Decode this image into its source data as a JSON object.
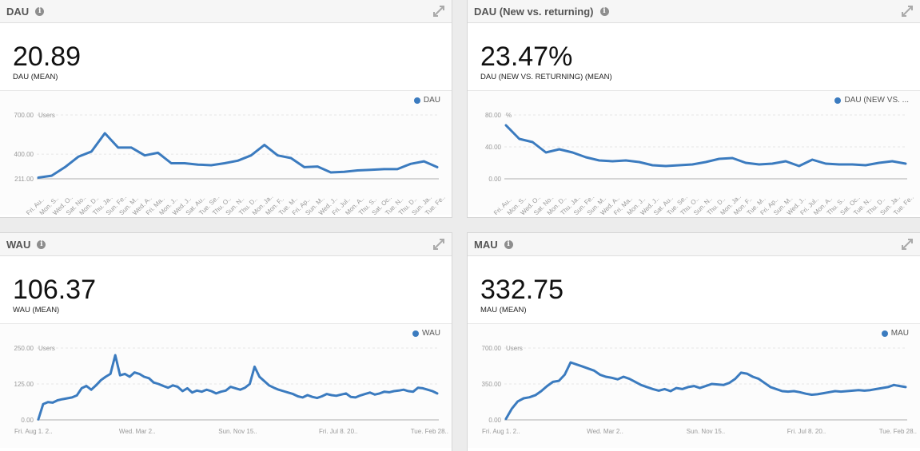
{
  "colors": {
    "series": "#3b7bbf",
    "grid": "#e6e6e6",
    "axis": "#c8c8c8",
    "text": "#9a9a9a"
  },
  "widgets": [
    {
      "title": "DAU",
      "kpi_value": "20.89",
      "kpi_label": "DAU (MEAN)",
      "legend": "DAU",
      "unit": "Users",
      "info_icon": "info-icon",
      "expand_icon": "expand-icon"
    },
    {
      "title": "DAU (New vs. returning)",
      "kpi_value": "23.47%",
      "kpi_label": "DAU (NEW VS. RETURNING) (MEAN)",
      "legend": "DAU (NEW VS. ...",
      "unit": "%",
      "info_icon": "info-icon",
      "expand_icon": "expand-icon"
    },
    {
      "title": "WAU",
      "kpi_value": "106.37",
      "kpi_label": "WAU (MEAN)",
      "legend": "WAU",
      "unit": "Users",
      "info_icon": "info-icon",
      "expand_icon": "expand-icon"
    },
    {
      "title": "MAU",
      "kpi_value": "332.75",
      "kpi_label": "MAU (MEAN)",
      "legend": "MAU",
      "unit": "Users",
      "info_icon": "info-icon",
      "expand_icon": "expand-icon"
    }
  ],
  "chart_data": [
    {
      "type": "line",
      "title": "DAU",
      "ylabel": "Users",
      "y_ticks": [
        "211.00",
        "400.00",
        "700.00"
      ],
      "ylim": [
        211,
        700
      ],
      "grid": true,
      "legend_placement": "top-right",
      "x_tick_labels": [
        "Fri. Au..",
        "Mon. S..",
        "Wed. O..",
        "Sat. No..",
        "Mon. D..",
        "Thu. Ja..",
        "Sun. Fe..",
        "Sun. M..",
        "Wed. A..",
        "Fri. Ma..",
        "Mon. J..",
        "Wed. J..",
        "Sat. Au..",
        "Tue. Se..",
        "Thu. O..",
        "Sun. N..",
        "Thu. D..",
        "Mon. Ja..",
        "Mon. F..",
        "Tue. M..",
        "Fri. Ap..",
        "Sun. M..",
        "Wed. J..",
        "Fri. Jul..",
        "Mon. A..",
        "Thu. S..",
        "Sat. Oc..",
        "Tue. N..",
        "Thu. D..",
        "Sun. Ja..",
        "Tue. Fe.."
      ],
      "series": [
        {
          "name": "DAU",
          "values": [
            220,
            235,
            300,
            380,
            420,
            560,
            450,
            450,
            390,
            410,
            330,
            330,
            320,
            315,
            330,
            350,
            390,
            470,
            390,
            370,
            300,
            305,
            260,
            265,
            275,
            280,
            285,
            285,
            325,
            345,
            300
          ]
        }
      ]
    },
    {
      "type": "line",
      "title": "DAU (New vs. returning)",
      "ylabel": "%",
      "y_ticks": [
        "0.00",
        "40.00",
        "80.00"
      ],
      "ylim": [
        0,
        80
      ],
      "grid": true,
      "legend_placement": "top-right",
      "x_tick_labels": [
        "Fri. Au..",
        "Mon. S..",
        "Wed. O..",
        "Sat. No..",
        "Mon. D..",
        "Thu. Ja..",
        "Sun. Fe..",
        "Sun. M..",
        "Wed. A..",
        "Fri. Ma..",
        "Mon. J..",
        "Wed. J..",
        "Sat. Au..",
        "Tue. Se..",
        "Thu. O..",
        "Sun. N..",
        "Thu. D..",
        "Mon. Ja..",
        "Mon. F..",
        "Tue. M..",
        "Fri. Ap..",
        "Sun. M..",
        "Wed. J..",
        "Fri. Jul..",
        "Mon. A..",
        "Thu. S..",
        "Sat. Oc..",
        "Tue. N..",
        "Thu. D..",
        "Sun. Ja..",
        "Tue. Fe.."
      ],
      "series": [
        {
          "name": "DAU (NEW VS. ...",
          "values": [
            67,
            50,
            46,
            33,
            37,
            33,
            27,
            23,
            22,
            23,
            21,
            17,
            16,
            17,
            18,
            21,
            25,
            26,
            20,
            18,
            19,
            22,
            16,
            24,
            19,
            18,
            18,
            17,
            20,
            22,
            19
          ]
        }
      ]
    },
    {
      "type": "line",
      "title": "WAU",
      "ylabel": "Users",
      "y_ticks": [
        "0.00",
        "125.00",
        "250.00"
      ],
      "ylim": [
        0,
        250
      ],
      "grid": true,
      "legend_placement": "top-right",
      "x_tick_labels": [
        "Fri. Aug 1. 2..",
        "Wed. Mar 2..",
        "Sun. Nov 15..",
        "Fri. Jul 8. 20..",
        "Tue. Feb 28.."
      ],
      "series": [
        {
          "name": "WAU",
          "values": [
            2,
            55,
            62,
            60,
            68,
            72,
            75,
            78,
            85,
            110,
            118,
            105,
            120,
            138,
            150,
            160,
            225,
            155,
            160,
            150,
            165,
            160,
            150,
            145,
            130,
            125,
            118,
            112,
            120,
            115,
            100,
            110,
            95,
            102,
            98,
            105,
            100,
            92,
            98,
            102,
            115,
            110,
            105,
            112,
            125,
            185,
            150,
            135,
            120,
            112,
            105,
            100,
            95,
            90,
            82,
            78,
            86,
            80,
            76,
            82,
            90,
            86,
            84,
            88,
            92,
            80,
            78,
            85,
            90,
            95,
            88,
            92,
            98,
            96,
            100,
            102,
            105,
            100,
            98,
            112,
            110,
            105,
            100,
            92
          ]
        }
      ]
    },
    {
      "type": "line",
      "title": "MAU",
      "ylabel": "Users",
      "y_ticks": [
        "0.00",
        "350.00",
        "700.00"
      ],
      "ylim": [
        0,
        700
      ],
      "grid": true,
      "legend_placement": "top-right",
      "x_tick_labels": [
        "Fri. Aug 1. 2..",
        "Wed. Mar 2..",
        "Sun. Nov 15..",
        "Fri. Jul 8. 20..",
        "Tue. Feb 28.."
      ],
      "series": [
        {
          "name": "MAU",
          "values": [
            10,
            110,
            180,
            210,
            220,
            240,
            280,
            330,
            370,
            380,
            440,
            560,
            540,
            520,
            500,
            480,
            440,
            420,
            410,
            395,
            420,
            400,
            370,
            340,
            320,
            300,
            285,
            300,
            280,
            310,
            300,
            320,
            330,
            310,
            330,
            350,
            345,
            340,
            360,
            400,
            460,
            450,
            420,
            400,
            360,
            320,
            300,
            280,
            275,
            280,
            270,
            255,
            245,
            250,
            260,
            270,
            280,
            275,
            280,
            285,
            290,
            285,
            290,
            300,
            310,
            320,
            340,
            330,
            320
          ]
        }
      ]
    }
  ]
}
